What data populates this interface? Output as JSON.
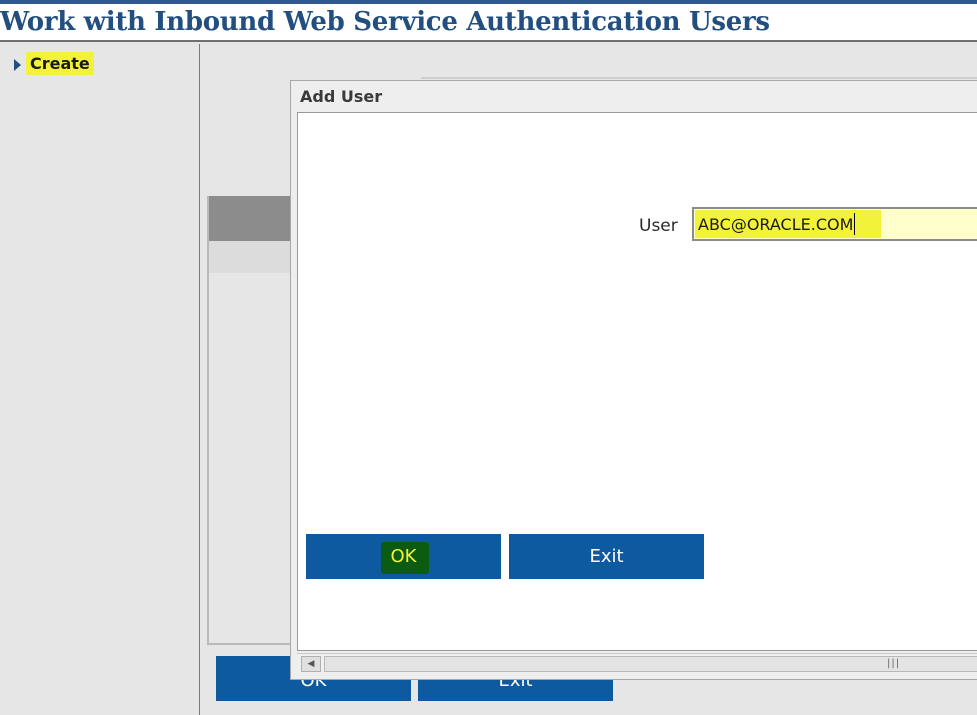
{
  "page": {
    "title": "Work with Inbound Web Service Authentication Users"
  },
  "sidebar": {
    "items": [
      {
        "label": "Create",
        "icon": "triangle-right-icon",
        "highlighted": true
      }
    ]
  },
  "background": {
    "buttons": {
      "ok_label": "OK",
      "exit_label": "Exit"
    }
  },
  "dialog": {
    "title": "Add User",
    "user_label": "User",
    "user_value": "ABC@ORACLE.COM",
    "ok_label": "OK",
    "exit_label": "Exit"
  },
  "colors": {
    "title_text": "#224f80",
    "button_blue": "#0e5aa0",
    "highlight_yellow": "#f2f23a",
    "highlight_green": "#0b5b12",
    "input_background": "#ffffcc"
  }
}
